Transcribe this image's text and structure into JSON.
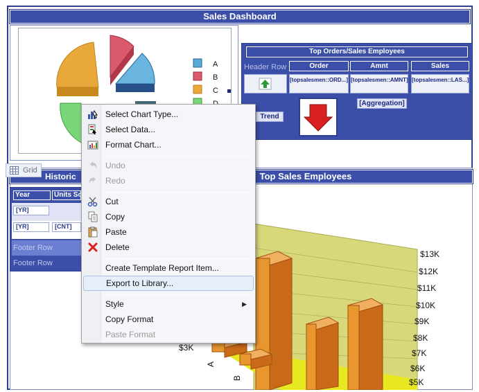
{
  "dashboard": {
    "title": "Sales Dashboard"
  },
  "pie": {
    "legend": [
      "A",
      "B",
      "C",
      "D"
    ],
    "colors": [
      "#e8a83a",
      "#d95a6a",
      "#5aa8d8",
      "#7ad67a"
    ]
  },
  "orders": {
    "title": "Top Orders/Sales Employees",
    "header_row_label": "Header Row",
    "columns": [
      "Order",
      "Amnt",
      "Sales"
    ],
    "fields": [
      "[topsalesmen::ORD...]",
      "[topsalesmen::AMNT]",
      "[topsalesmen::LAS...]"
    ],
    "trend_label": "Trend",
    "aggregation_label": "[Aggregation]"
  },
  "historic": {
    "title": "Historic S",
    "columns": [
      "Year",
      "Units So"
    ],
    "field_row1": "[YR]",
    "field_row2": [
      "[YR]",
      "[CNT]"
    ],
    "footer_rows": [
      "Footer Row",
      "Footer Row"
    ]
  },
  "grid_tab": {
    "label": "Grid"
  },
  "top_sales": {
    "title": "Top Sales Employees",
    "y_ticks": [
      "$13K",
      "$12K",
      "$11K",
      "$10K",
      "$9K",
      "$8K",
      "$7K",
      "$6K",
      "$5K",
      "$3K"
    ],
    "x_labels": [
      "A",
      "B"
    ]
  },
  "menu": {
    "items": [
      {
        "label": "Select Chart Type...",
        "icon": "chart-type-icon",
        "enabled": true
      },
      {
        "label": "Select Data...",
        "icon": "select-data-icon",
        "enabled": true
      },
      {
        "label": "Format Chart...",
        "icon": "format-chart-icon",
        "enabled": true
      },
      {
        "label": "Undo",
        "icon": "undo-icon",
        "enabled": false
      },
      {
        "label": "Redo",
        "icon": "redo-icon",
        "enabled": false
      },
      {
        "label": "Cut",
        "icon": "scissors-icon",
        "enabled": true
      },
      {
        "label": "Copy",
        "icon": "copy-icon",
        "enabled": true
      },
      {
        "label": "Paste",
        "icon": "paste-icon",
        "enabled": true
      },
      {
        "label": "Delete",
        "icon": "delete-icon",
        "enabled": true
      },
      {
        "label": "Create Template Report Item...",
        "icon": "",
        "enabled": true
      },
      {
        "label": "Export to Library...",
        "icon": "",
        "enabled": true
      },
      {
        "label": "Style",
        "icon": "",
        "enabled": true
      },
      {
        "label": "Copy Format",
        "icon": "",
        "enabled": true
      },
      {
        "label": "Paste Format",
        "icon": "",
        "enabled": false
      }
    ],
    "submenu_arrow": "▶"
  },
  "colors": {
    "band_blue": "#3b4fa8",
    "bar_orange": "#e8962e",
    "wall_yellow": "#d8d87a"
  }
}
